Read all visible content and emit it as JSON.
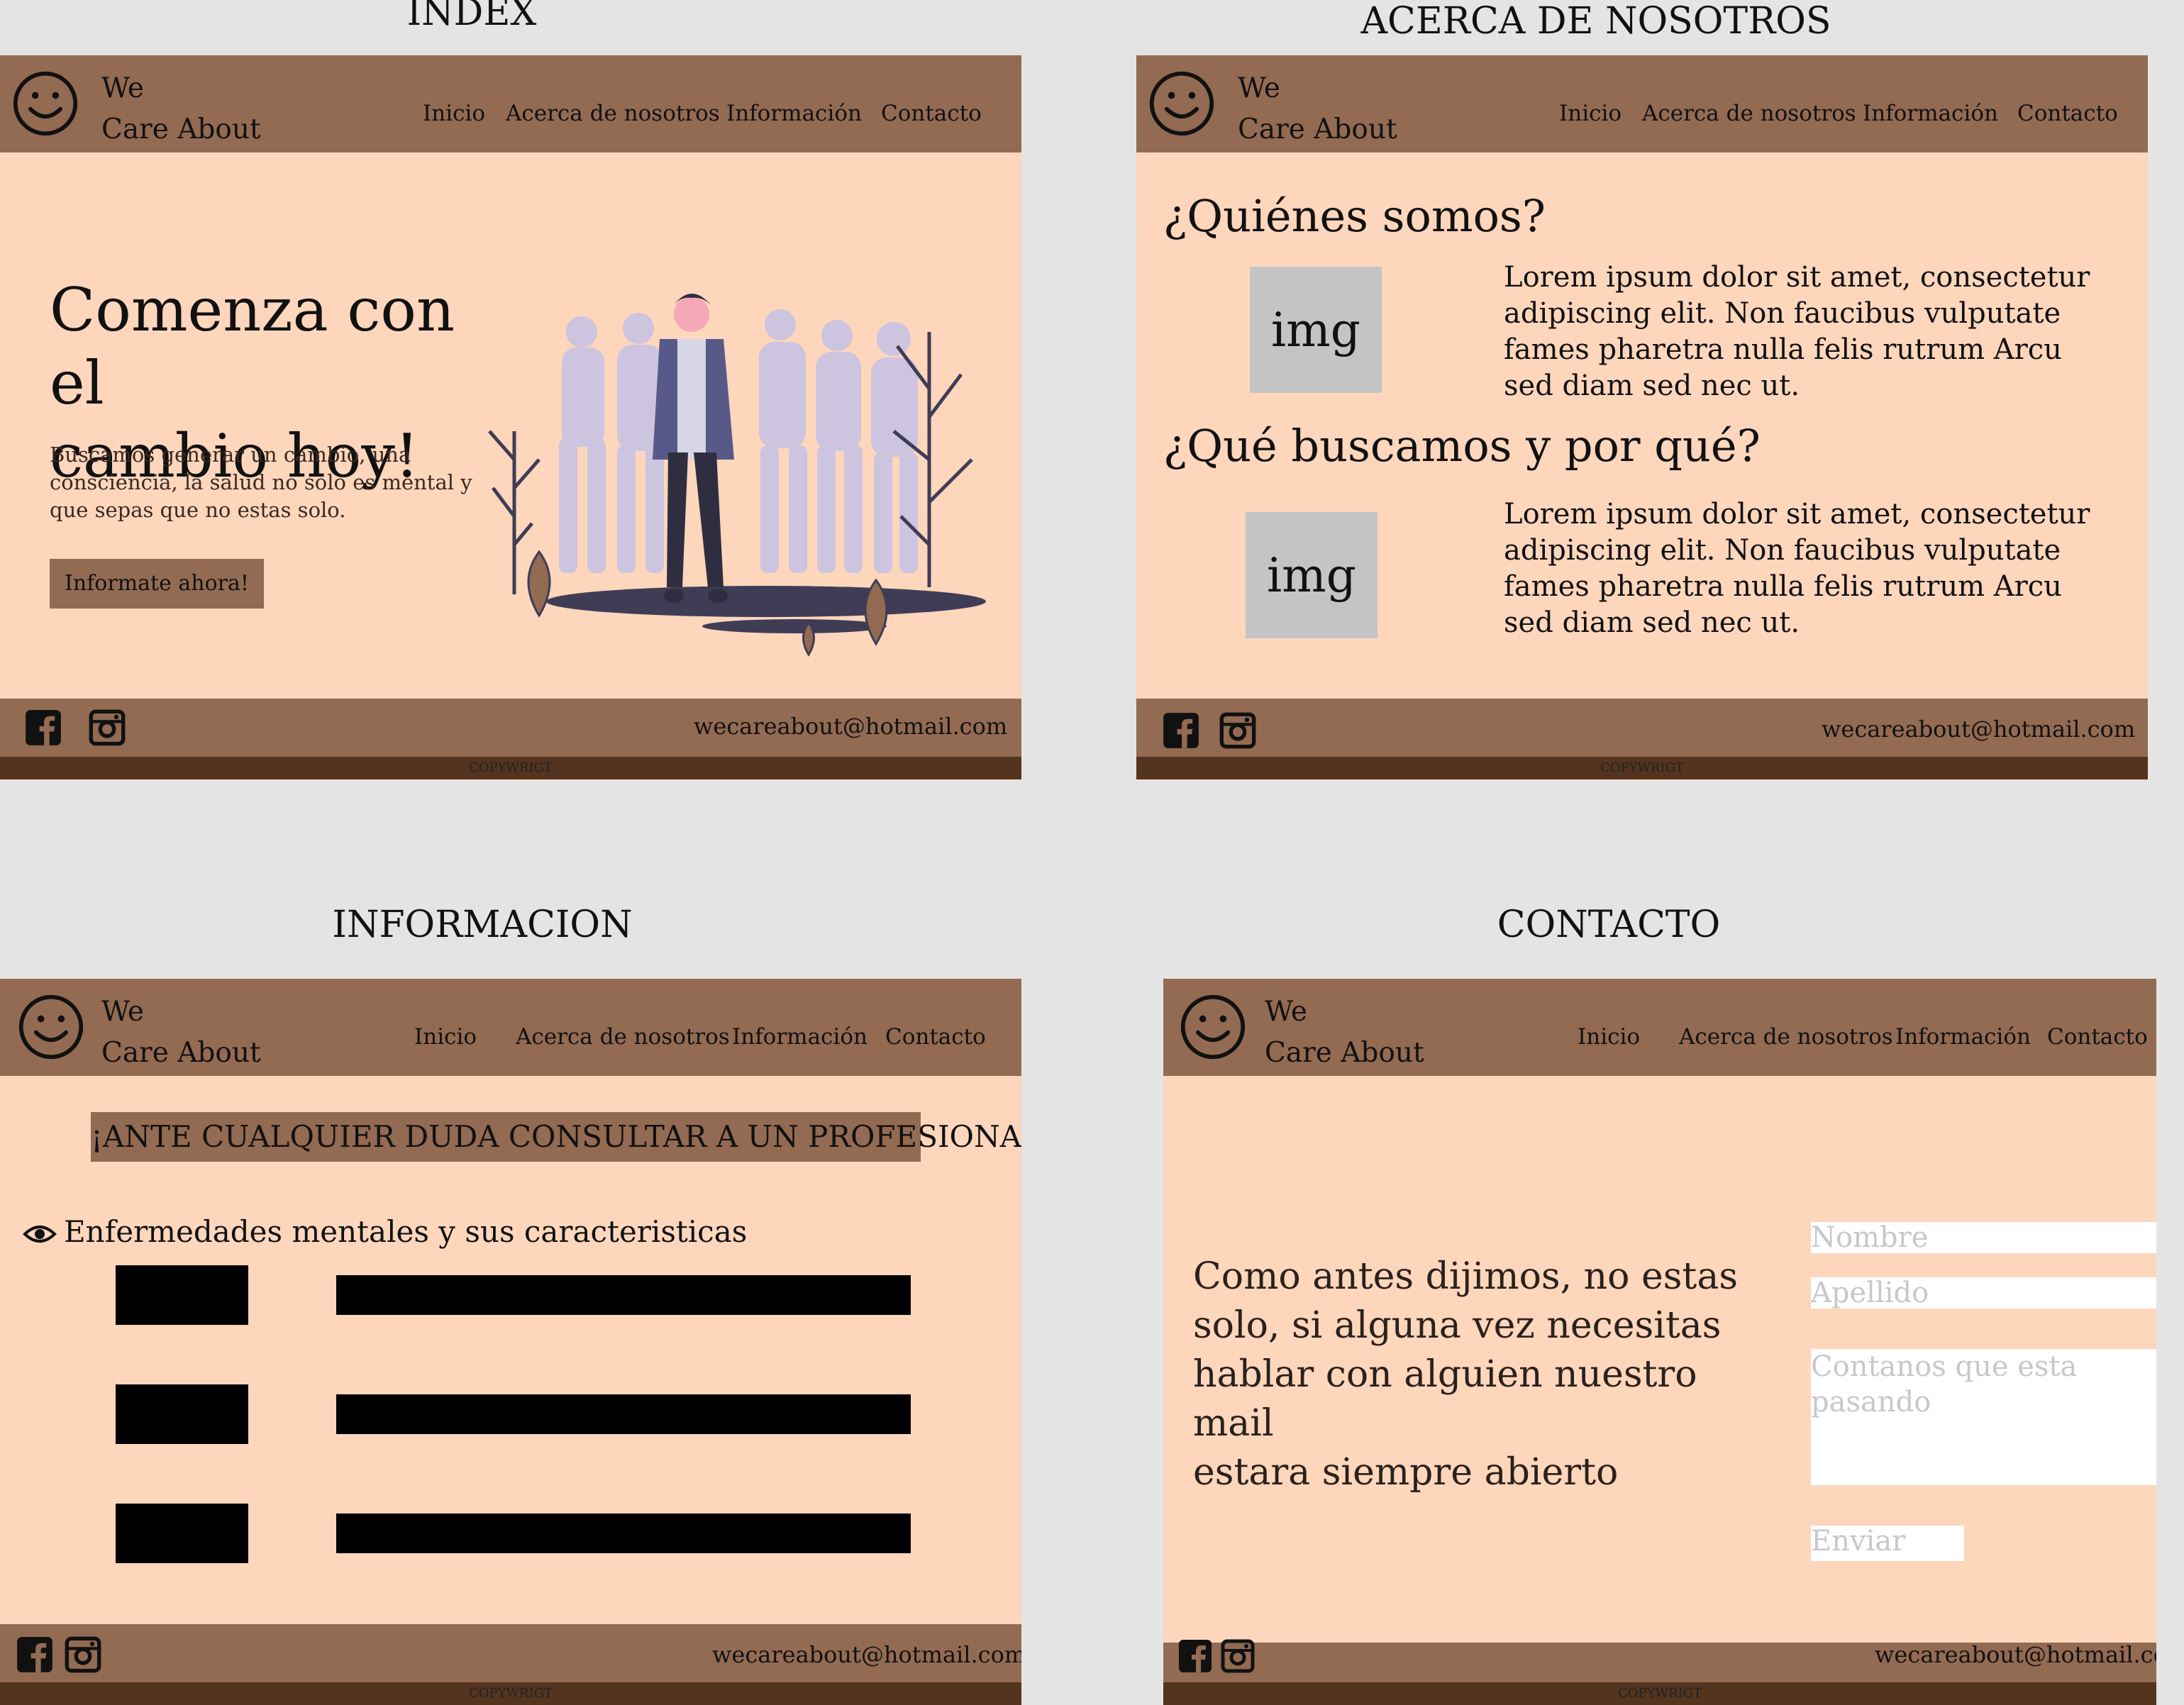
{
  "labels": {
    "index": "INDEX",
    "about": "ACERCA DE NOSOTROS",
    "info": "INFORMACION",
    "contact": "CONTACTO"
  },
  "brand": {
    "line1": "We",
    "line2": "Care About"
  },
  "nav": {
    "inicio": "Inicio",
    "acerca": "Acerca de nosotros",
    "informacion": "Información",
    "contacto": "Contacto"
  },
  "footer": {
    "email": "wecareabout@hotmail.com",
    "copyright": "COPYWRIGT"
  },
  "index": {
    "title_line1": "Comenza con el",
    "title_line2": "cambio hoy!",
    "text_line1": "Buscamos generar un cambio, una",
    "text_line2": "consciencia, la salud no solo es mental y",
    "text_line3": "que sepas que no estas solo.",
    "cta": "Informate ahora!"
  },
  "about": {
    "heading1": "¿Quiénes somos?",
    "heading2": "¿Qué buscamos y por qué?",
    "img_label": "img",
    "lorem_line1": "Lorem ipsum dolor sit amet, consectetur",
    "lorem_line2": "adipiscing elit. Non faucibus vulputate",
    "lorem_line3": "fames pharetra nulla felis  rutrum  Arcu",
    "lorem_line4": "sed diam sed nec ut."
  },
  "info": {
    "banner": "¡ANTE CUALQUIER DUDA CONSULTAR A UN PROFESIONAL!",
    "section_title": "Enfermedades mentales y sus caracteristicas"
  },
  "contact": {
    "text_line1": "Como antes dijimos, no estas",
    "text_line2": "solo, si alguna vez necesitas",
    "text_line3": "hablar con alguien nuestro mail",
    "text_line4": "estara siempre abierto",
    "nombre_placeholder": "Nombre",
    "apellido_placeholder": "Apellido",
    "mensaje_placeholder": "Contanos que esta pasando",
    "enviar": "Enviar"
  },
  "colors": {
    "background": "#e4e4e4",
    "panel": "#fdd6bc",
    "nav": "#936a52",
    "copyright_bar": "#54331f",
    "placeholder_box": "#c4c4c4"
  },
  "icons": [
    "smiley-logo-icon",
    "facebook-icon",
    "instagram-icon",
    "eye-icon"
  ]
}
